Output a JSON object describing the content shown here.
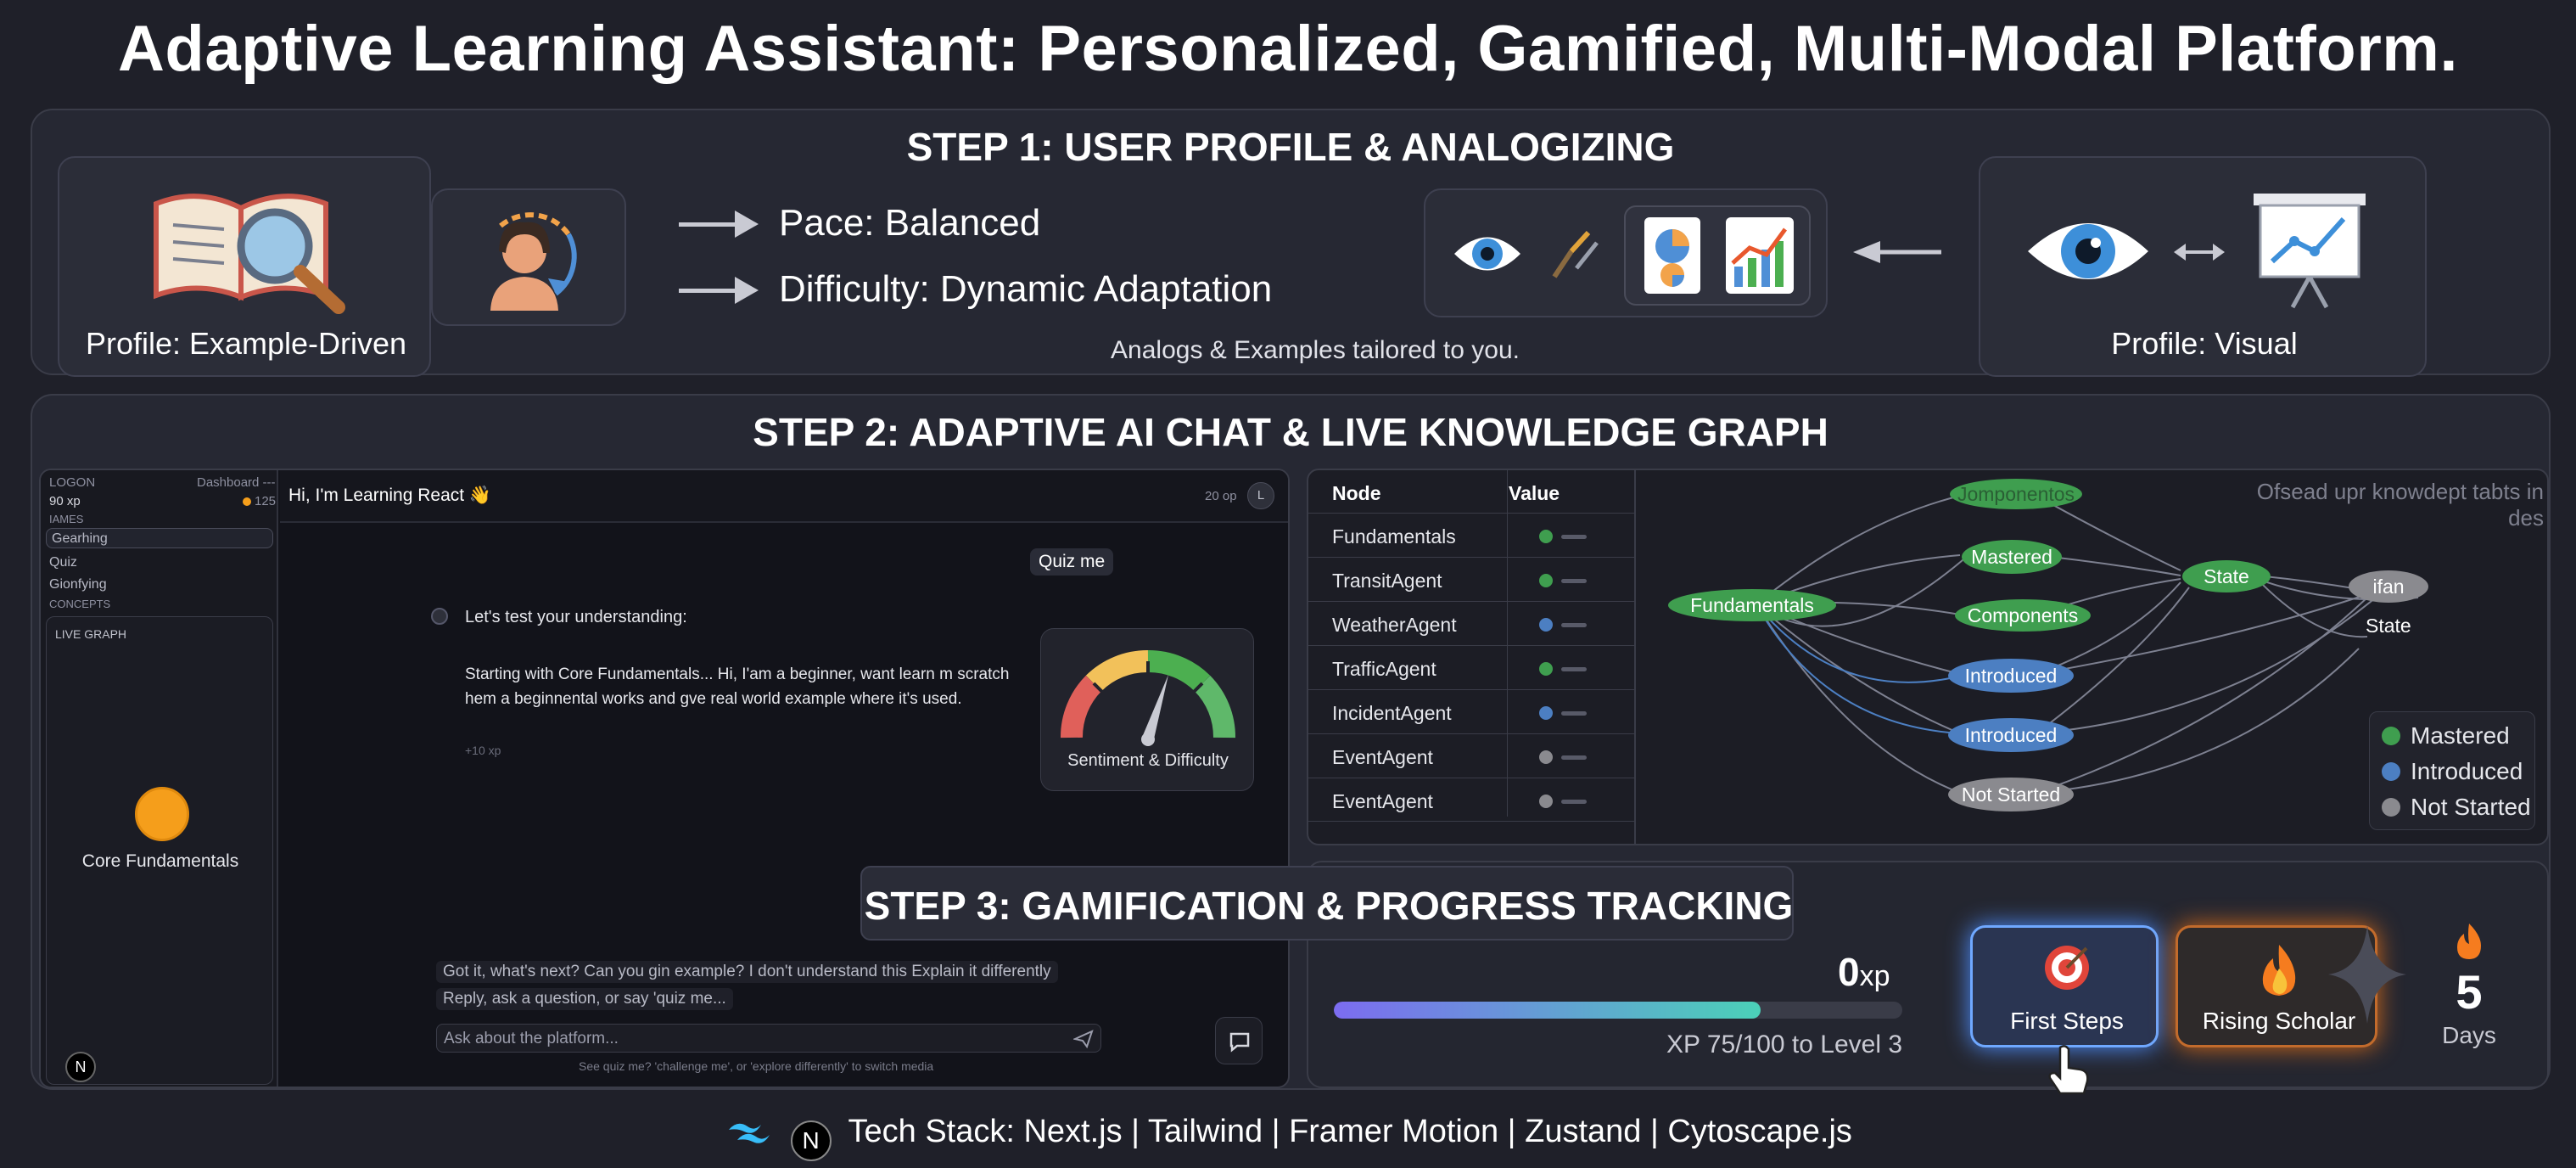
{
  "title": "Adaptive Learning Assistant: Personalized, Gamified, Multi-Modal Platform.",
  "step1": {
    "title": "STEP 1: USER PROFILE & ANALOGIZING",
    "profile_left": "Profile: Example-Driven",
    "pace": "Pace: Balanced",
    "difficulty": "Difficulty: Dynamic Adaptation",
    "caption": "Analogs & Examples tailored to you.",
    "profile_right": "Profile: Visual"
  },
  "step2": {
    "title": "STEP 2: ADAPTIVE AI CHAT & LIVE KNOWLEDGE GRAPH",
    "sidebar": {
      "logo": "LOGON",
      "dashboard": "Dashboard ---",
      "xp": "90 xp",
      "xp_right": "125",
      "section1": "IAMES",
      "items": [
        "Gearhing",
        "Quiz",
        "Gionfying"
      ],
      "section2": "CONCEPTS",
      "live_graph": "LIVE GRAPH",
      "concept_label": "Core Fundamentals",
      "avatar_letter": "N"
    },
    "chat": {
      "header": "Hi, I'm Learning React 👋",
      "header_xp": "20 op",
      "header_avatar": "L",
      "user_msg": "Quiz me",
      "ai_title": "Let's test your understanding:",
      "ai_body": "Starting with Core Fundamentals... Hi, I'am a beginner, want learn m scratch hem a beginnental works and gve real world example where it's used.",
      "ai_xp": "+10 xp",
      "gauge_label": "Sentiment & Difficulty",
      "suggestions": "Got it, what's next? Can you gin example? I don't understand this Explain it differently",
      "hint": "Reply, ask a question, or say 'quiz me...",
      "input_placeholder": "Ask about the platform...",
      "footnote": "See quiz me? 'challenge me', or 'explore differently' to switch media"
    },
    "table": {
      "headers": [
        "Node",
        "Value"
      ],
      "rows": [
        {
          "node": "Fundamentals",
          "status": "mastered"
        },
        {
          "node": "TransitAgent",
          "status": "mastered"
        },
        {
          "node": "WeatherAgent",
          "status": "introduced"
        },
        {
          "node": "TrafficAgent",
          "status": "mastered"
        },
        {
          "node": "IncidentAgent",
          "status": "introduced"
        },
        {
          "node": "EventAgent",
          "status": "not_started"
        },
        {
          "node": "EventAgent",
          "status": "not_started"
        }
      ]
    },
    "graph": {
      "overlay_text": "Ofsead upr knowdept tabts in des",
      "nodes": {
        "fundamentals": "Fundamentals",
        "top": "Jomponentos",
        "mastered": "Mastered",
        "components": "Components",
        "introduced1": "Introduced",
        "introduced2": "Introduced",
        "not_started": "Not Started",
        "state": "State",
        "ifan": "ifan",
        "state2": "State"
      },
      "legend": [
        "Mastered",
        "Introduced",
        "Not Started"
      ]
    },
    "colors": {
      "mastered": "#3f9e4f",
      "introduced": "#4c7fc2",
      "not_started": "#8a8a8f",
      "accent_orange": "#f59e1b"
    }
  },
  "step3": {
    "title": "STEP 3: GAMIFICATION & PROGRESS TRACKING",
    "xp_value": "0",
    "xp_unit": "xp",
    "progress": 0.75,
    "progress_label": "XP 75/100 to Level 3",
    "badges": [
      "First Steps",
      "Rising Scholar"
    ],
    "streak_number": "5",
    "streak_label": "Days"
  },
  "footer": "Tech Stack: Next.js | Tailwind | Framer Motion | Zustand | Cytoscape.js"
}
